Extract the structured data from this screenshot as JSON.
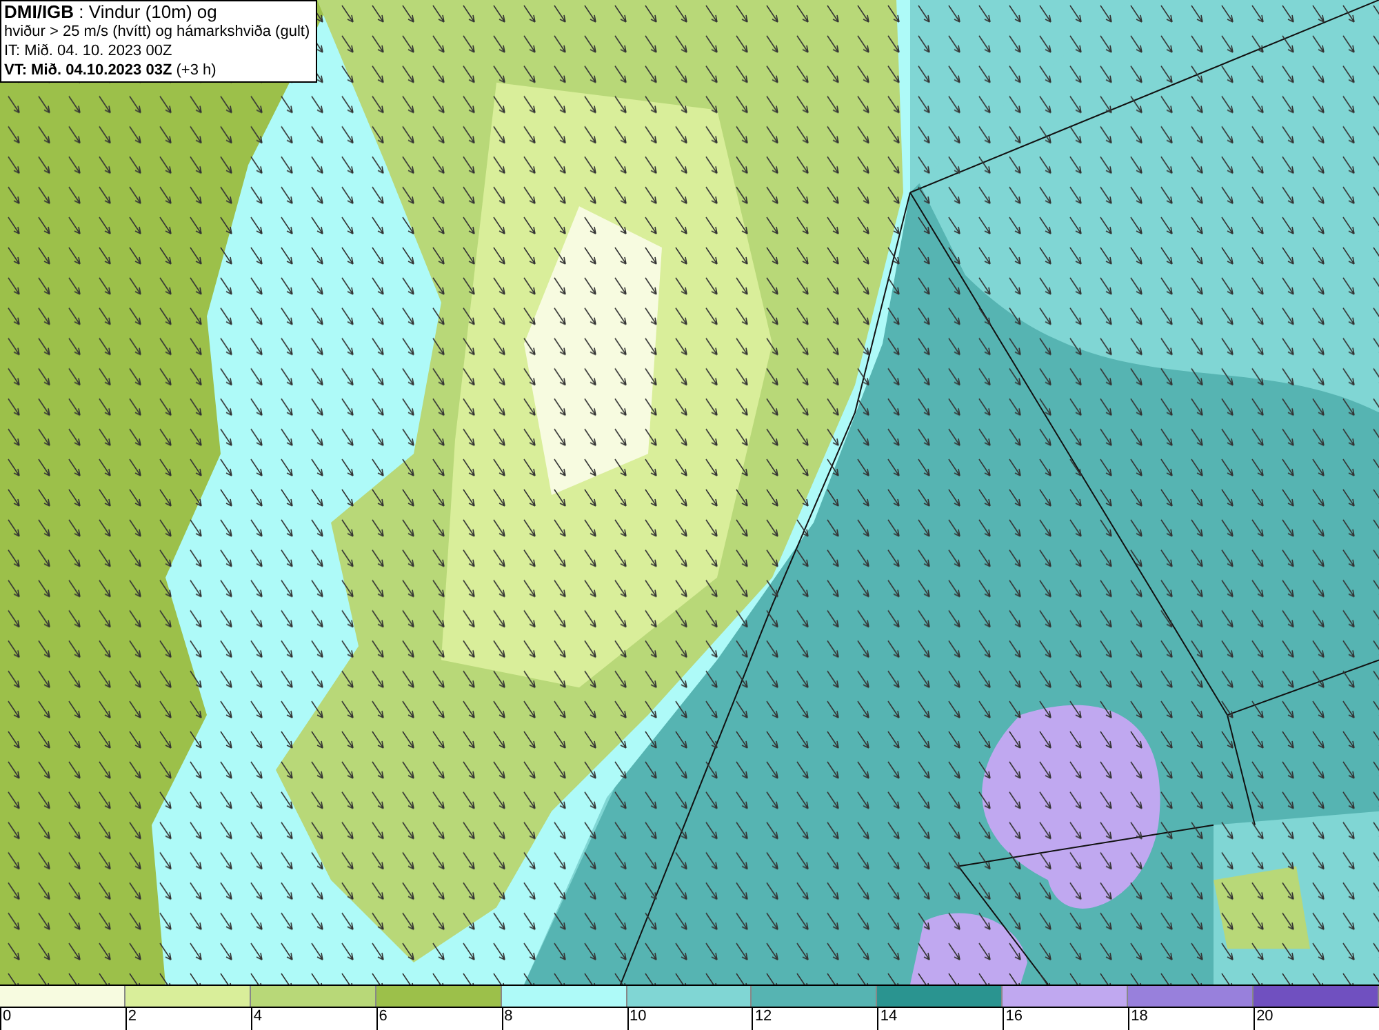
{
  "legend_box": {
    "lines": [
      "**DMI/IGB** : Vindur (10m) og",
      "hviður > 25 m/s (hvítt) og hámarkshviða (gult)",
      "IT: Mið. 04. 10. 2023 00Z",
      "**VT: Mið. 04.10.2023 03Z** (+3 h)"
    ]
  },
  "colorbar": {
    "bins": [
      {
        "color": "#f7fbe0"
      },
      {
        "color": "#d9ee9a"
      },
      {
        "color": "#b8d878"
      },
      {
        "color": "#9cc04a"
      },
      {
        "color": "#aefaf8"
      },
      {
        "color": "#80d6d4"
      },
      {
        "color": "#56b4b2"
      },
      {
        "color": "#2a9490"
      },
      {
        "color": "#c0a8f0"
      },
      {
        "color": "#9880dc"
      },
      {
        "color": "#7050c0"
      }
    ],
    "ticks": [
      "0",
      "2",
      "4",
      "6",
      "8",
      "10",
      "12",
      "14",
      "16",
      "18",
      "20"
    ]
  }
}
